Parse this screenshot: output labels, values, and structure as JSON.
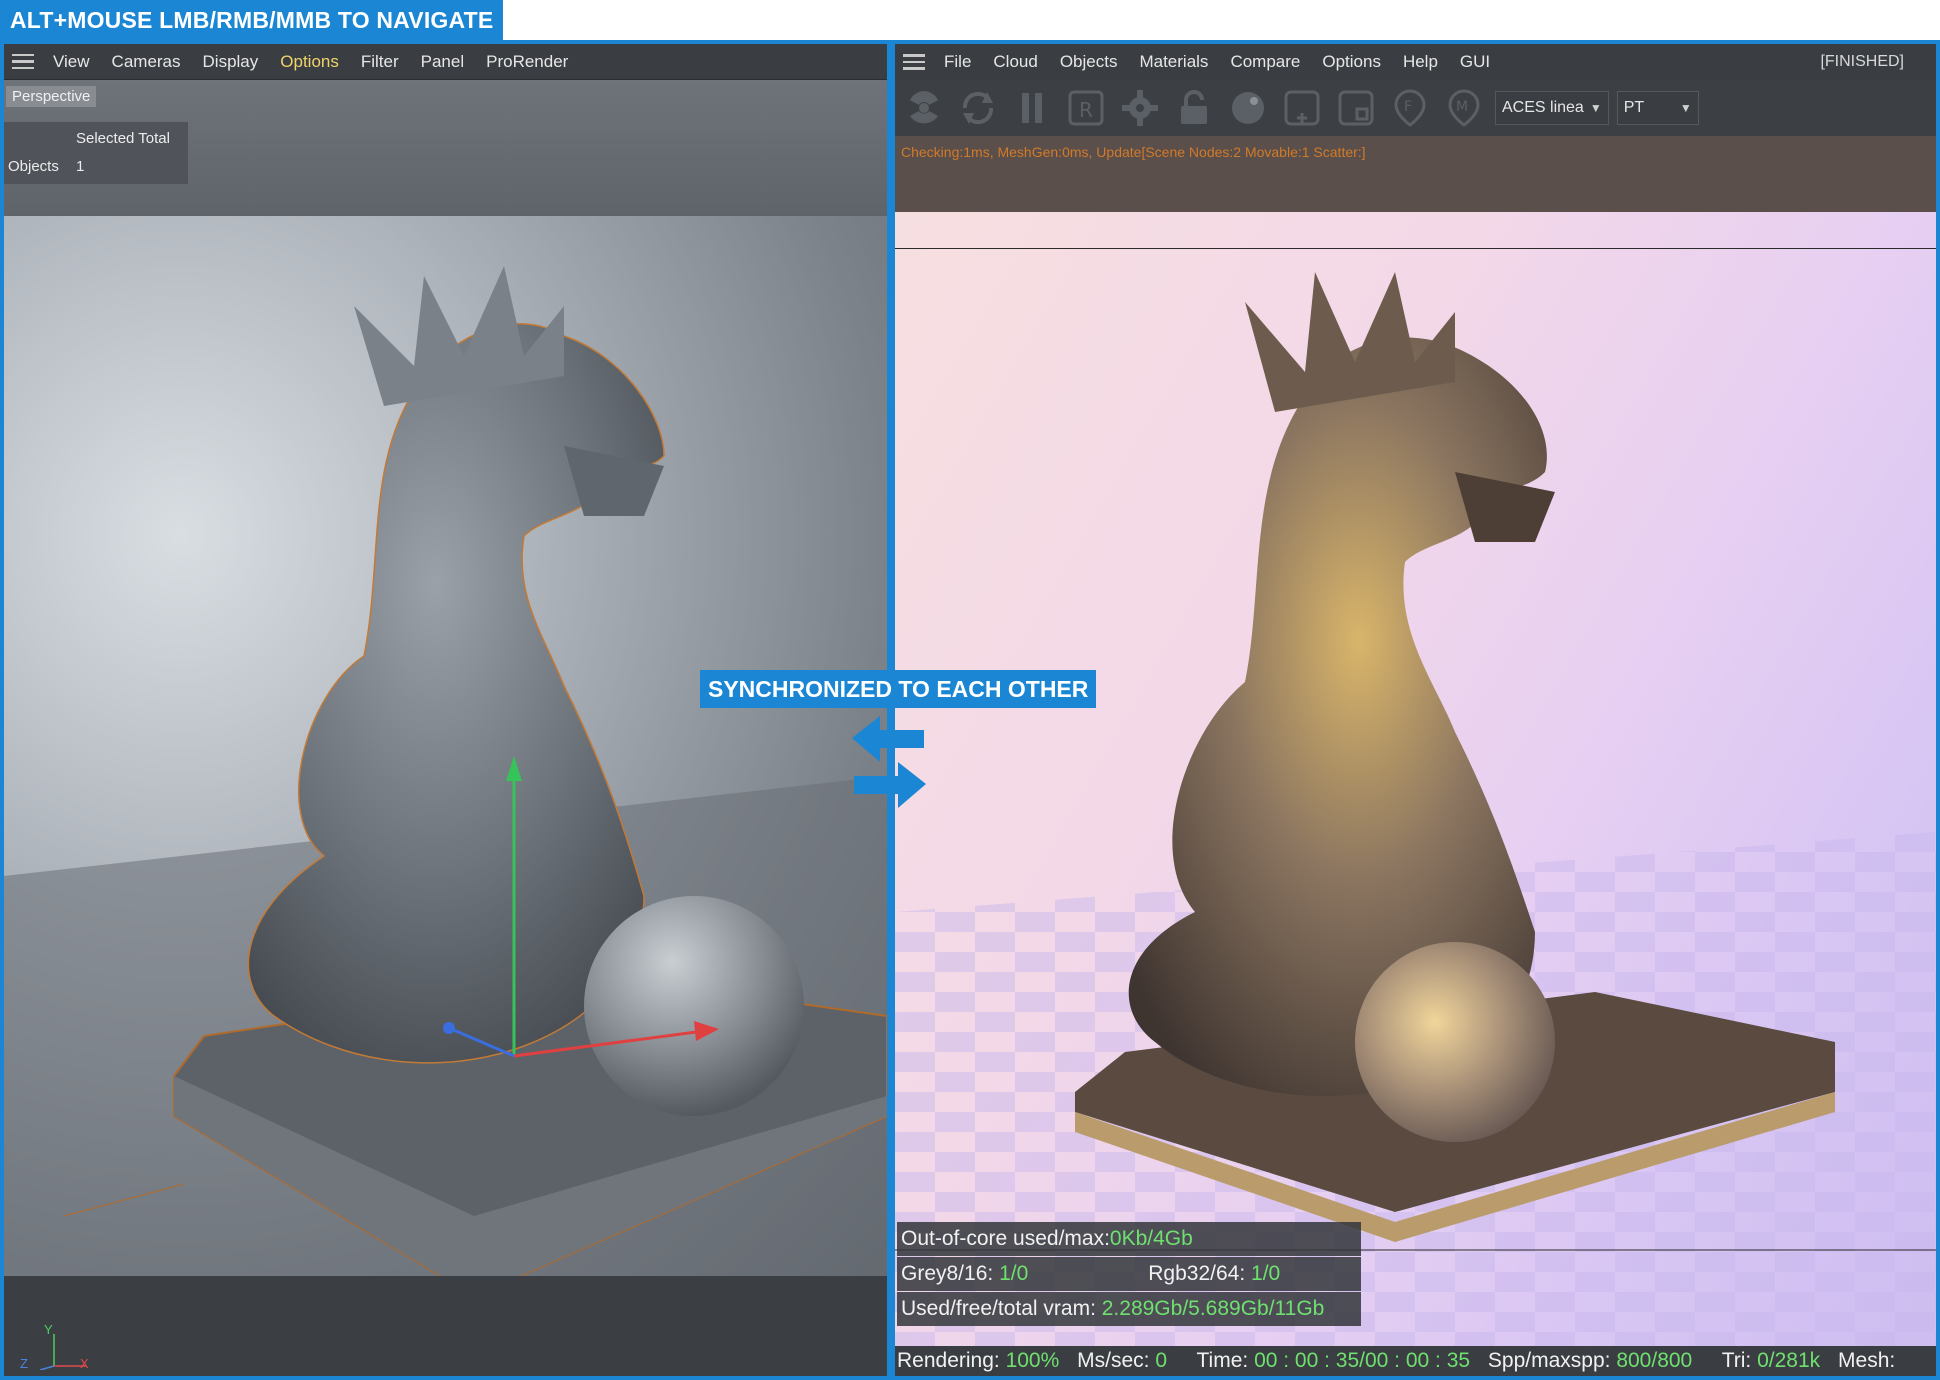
{
  "banner": {
    "text": "ALT+MOUSE LMB/RMB/MMB TO NAVIGATE"
  },
  "sync": {
    "label": "SYNCHRONIZED TO EACH OTHER"
  },
  "left": {
    "menu": [
      "View",
      "Cameras",
      "Display",
      "Options",
      "Filter",
      "Panel",
      "ProRender"
    ],
    "active_menu": "Options",
    "viewport_label": "Perspective",
    "stats": {
      "header": "Selected Total",
      "row_label": "Objects",
      "row_value": "1"
    },
    "axis": {
      "y": "Y",
      "x": "X",
      "z": "Z"
    }
  },
  "right": {
    "menu": [
      "File",
      "Cloud",
      "Objects",
      "Materials",
      "Compare",
      "Options",
      "Help",
      "GUI"
    ],
    "status": "[FINISHED]",
    "colorspace": "ACES linea",
    "kernel": "PT",
    "toolbar_icons": [
      "radiation-icon",
      "refresh-icon",
      "pause-icon",
      "region-icon",
      "settings-gear-icon",
      "lock-icon",
      "material-ball-icon",
      "add-icon",
      "clay-icon",
      "focus-pin-icon",
      "material-pin-icon"
    ],
    "info_strip": "Checking:1ms, MeshGen:0ms, Update[Scene Nodes:2 Movable:1 Scatter:]",
    "info": {
      "ooc_label": "Out-of-core used/max:",
      "ooc_value": "0Kb/4Gb",
      "grey_label": "Grey8/16:",
      "grey_value": "1/0",
      "rgb_label": "Rgb32/64:",
      "rgb_value": "1/0",
      "vram_label": "Used/free/total vram:",
      "vram_value": "2.289Gb/5.689Gb/11Gb"
    },
    "bottom": {
      "rendering_label": "Rendering:",
      "rendering_value": "100%",
      "mssec_label": "Ms/sec:",
      "mssec_value": "0",
      "time_label": "Time:",
      "time_value": "00 : 00 : 35/00 : 00 : 35",
      "spp_label": "Spp/maxspp:",
      "spp_value": "800/800",
      "tri_label": "Tri:",
      "tri_value": "0/281k",
      "mesh_label": "Mesh:"
    }
  }
}
